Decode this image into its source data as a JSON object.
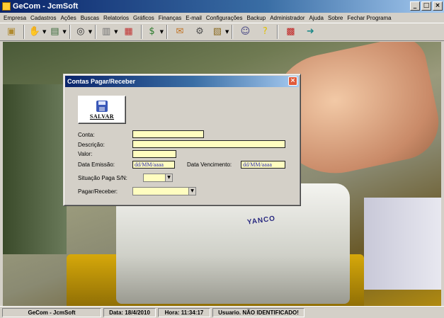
{
  "window": {
    "title": "GeCom - JcmSoft",
    "buttons": {
      "minimize": "_",
      "maximize": "□",
      "close": "×"
    }
  },
  "menu": [
    "Empresa",
    "Cadastros",
    "Ações",
    "Buscas",
    "Relatorios",
    "Gráficos",
    "Finanças",
    "E-mail",
    "Configurações",
    "Backup",
    "Administrador",
    "Ajuda",
    "Sobre",
    "Fechar Programa"
  ],
  "toolbar": [
    {
      "name": "company-icon",
      "glyph": "▣",
      "color": "#b08a30",
      "dropdown": false
    },
    {
      "name": "handshake-icon",
      "glyph": "✋",
      "color": "#6a7ab0",
      "dropdown": true
    },
    {
      "name": "register-icon",
      "glyph": "▤",
      "color": "#3a6a3a",
      "dropdown": true
    },
    {
      "name": "binoculars-icon",
      "glyph": "◎",
      "color": "#303030",
      "dropdown": true
    },
    {
      "name": "report-icon",
      "glyph": "▥",
      "color": "#707070",
      "dropdown": true
    },
    {
      "name": "chart-icon",
      "glyph": "▦",
      "color": "#c03030",
      "dropdown": false
    },
    {
      "name": "money-icon",
      "glyph": "$",
      "color": "#2a7a2a",
      "dropdown": true
    },
    {
      "name": "email-icon",
      "glyph": "✉",
      "color": "#c07020",
      "dropdown": false
    },
    {
      "name": "settings-icon",
      "glyph": "⚙",
      "color": "#505050",
      "dropdown": false
    },
    {
      "name": "backup-icon",
      "glyph": "▧",
      "color": "#8a6a20",
      "dropdown": true
    },
    {
      "name": "admin-icon",
      "glyph": "☺",
      "color": "#404080",
      "dropdown": false
    },
    {
      "name": "help-icon",
      "glyph": "?",
      "color": "#e0c000",
      "dropdown": false
    },
    {
      "name": "calculator-icon",
      "glyph": "▩",
      "color": "#c02020",
      "dropdown": false
    },
    {
      "name": "exit-icon",
      "glyph": "➜",
      "color": "#208a8a",
      "dropdown": false
    }
  ],
  "workspace": {
    "printer_label": "YANCO"
  },
  "dialog": {
    "title": "Contas Pagar/Receber",
    "close": "×",
    "save_label": "SALVAR",
    "labels": {
      "conta": "Conta:",
      "descricao": "Descrição:",
      "valor": "Valor:",
      "data_emissao": "Data Emissão:",
      "data_vencimento": "Data Vencimento:",
      "situacao": "Situação Paga S/N:",
      "pagar_receber": "Pagar/Receber:"
    },
    "values": {
      "conta": "",
      "descricao": "",
      "valor": "",
      "data_emissao": "dd/MM/aaaa",
      "data_vencimento": "dd/MM/aaaa",
      "situacao": "",
      "pagar_receber": ""
    },
    "dropdown_arrow": "▼"
  },
  "status": {
    "app": "GeCom - JcmSoft",
    "date": "Data: 18/4/2010",
    "time": "Hora: 11:34:17",
    "user": "Usuario. NÃO IDENTIFICADO!"
  },
  "colors": {
    "title_gradient_start": "#0a246a",
    "title_gradient_end": "#a6caf0",
    "field_background": "#fffdc0",
    "date_text": "#2a2ab0"
  }
}
